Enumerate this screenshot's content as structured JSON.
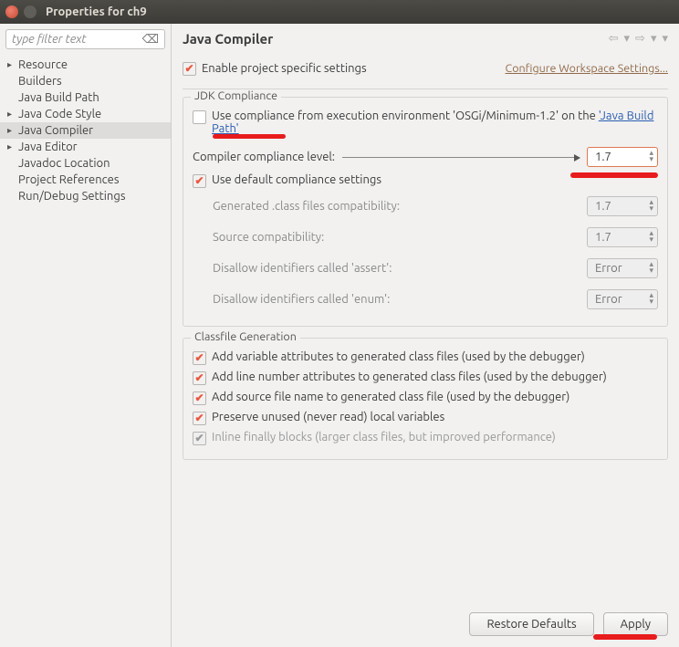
{
  "window": {
    "title": "Properties for ch9"
  },
  "sidebar": {
    "filter_placeholder": "type filter text",
    "items": [
      {
        "label": "Resource",
        "expandable": true
      },
      {
        "label": "Builders",
        "expandable": false
      },
      {
        "label": "Java Build Path",
        "expandable": false
      },
      {
        "label": "Java Code Style",
        "expandable": true
      },
      {
        "label": "Java Compiler",
        "expandable": true,
        "selected": true
      },
      {
        "label": "Java Editor",
        "expandable": true
      },
      {
        "label": "Javadoc Location",
        "expandable": false
      },
      {
        "label": "Project References",
        "expandable": false
      },
      {
        "label": "Run/Debug Settings",
        "expandable": false
      }
    ]
  },
  "header": {
    "title": "Java Compiler"
  },
  "enable": {
    "label": "Enable project specific settings",
    "link": "Configure Workspace Settings..."
  },
  "jdk": {
    "legend": "JDK Compliance",
    "use_exec_pre": "Use compliance from execution environment 'OSGi/Minimum-1.2' on the ",
    "use_exec_link": "'Java Build Path'",
    "compliance_label": "Compiler compliance level:",
    "compliance_value": "1.7",
    "use_default": "Use default compliance settings",
    "gen_class": "Generated .class files compatibility:",
    "gen_class_val": "1.7",
    "src_compat": "Source compatibility:",
    "src_compat_val": "1.7",
    "assert_lbl": "Disallow identifiers called 'assert':",
    "assert_val": "Error",
    "enum_lbl": "Disallow identifiers called 'enum':",
    "enum_val": "Error"
  },
  "classfile": {
    "legend": "Classfile Generation",
    "var_attr": "Add variable attributes to generated class files (used by the debugger)",
    "line_attr": "Add line number attributes to generated class files (used by the debugger)",
    "src_file": "Add source file name to generated class file (used by the debugger)",
    "preserve": "Preserve unused (never read) local variables",
    "inline": "Inline finally blocks (larger class files, but improved performance)"
  },
  "footer": {
    "restore": "Restore Defaults",
    "apply": "Apply"
  }
}
